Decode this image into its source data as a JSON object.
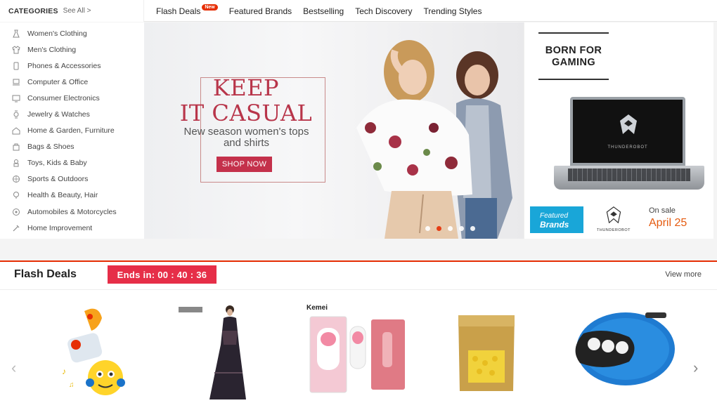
{
  "categories": {
    "title": "CATEGORIES",
    "see_all": "See All >",
    "items": [
      {
        "label": "Women's Clothing",
        "icon": "dress-icon"
      },
      {
        "label": "Men's Clothing",
        "icon": "shirt-icon"
      },
      {
        "label": "Phones & Accessories",
        "icon": "phone-icon"
      },
      {
        "label": "Computer & Office",
        "icon": "laptop-icon"
      },
      {
        "label": "Consumer Electronics",
        "icon": "monitor-icon"
      },
      {
        "label": "Jewelry & Watches",
        "icon": "watch-icon"
      },
      {
        "label": "Home & Garden, Furniture",
        "icon": "home-icon"
      },
      {
        "label": "Bags & Shoes",
        "icon": "bag-icon"
      },
      {
        "label": "Toys, Kids & Baby",
        "icon": "toy-icon"
      },
      {
        "label": "Sports & Outdoors",
        "icon": "ball-icon"
      },
      {
        "label": "Health & Beauty, Hair",
        "icon": "beauty-icon"
      },
      {
        "label": "Automobiles & Motorcycles",
        "icon": "wheel-icon"
      },
      {
        "label": "Home Improvement",
        "icon": "tools-icon"
      }
    ]
  },
  "nav": {
    "items": [
      {
        "label": "Flash Deals",
        "badge": "New"
      },
      {
        "label": "Featured Brands"
      },
      {
        "label": "Bestselling"
      },
      {
        "label": "Tech Discovery"
      },
      {
        "label": "Trending Styles"
      }
    ]
  },
  "banner": {
    "title_line1": "KEEP",
    "title_line2": "IT CASUAL",
    "subtitle": "New season women's tops and shirts",
    "cta": "SHOP NOW",
    "slide_count": 5,
    "active_slide": 1
  },
  "promo": {
    "headline": "BORN FOR GAMING",
    "screen_brand": "THUNDEROBOT",
    "featured_small": "Featured",
    "featured_big": "Brands",
    "logo_text": "THUNDEROBOT",
    "onsale_label": "On sale",
    "onsale_date": "April 25"
  },
  "flash_deals": {
    "title": "Flash Deals",
    "timer": "Ends in: 00 : 40 : 36",
    "view_more": "View more",
    "brand_label": "Kemei",
    "prev": "‹",
    "next": "›"
  },
  "colors": {
    "accent": "#e62e04",
    "banner_red": "#c4314b",
    "featured_blue": "#19a6d8",
    "sale_orange": "#e55b10"
  }
}
